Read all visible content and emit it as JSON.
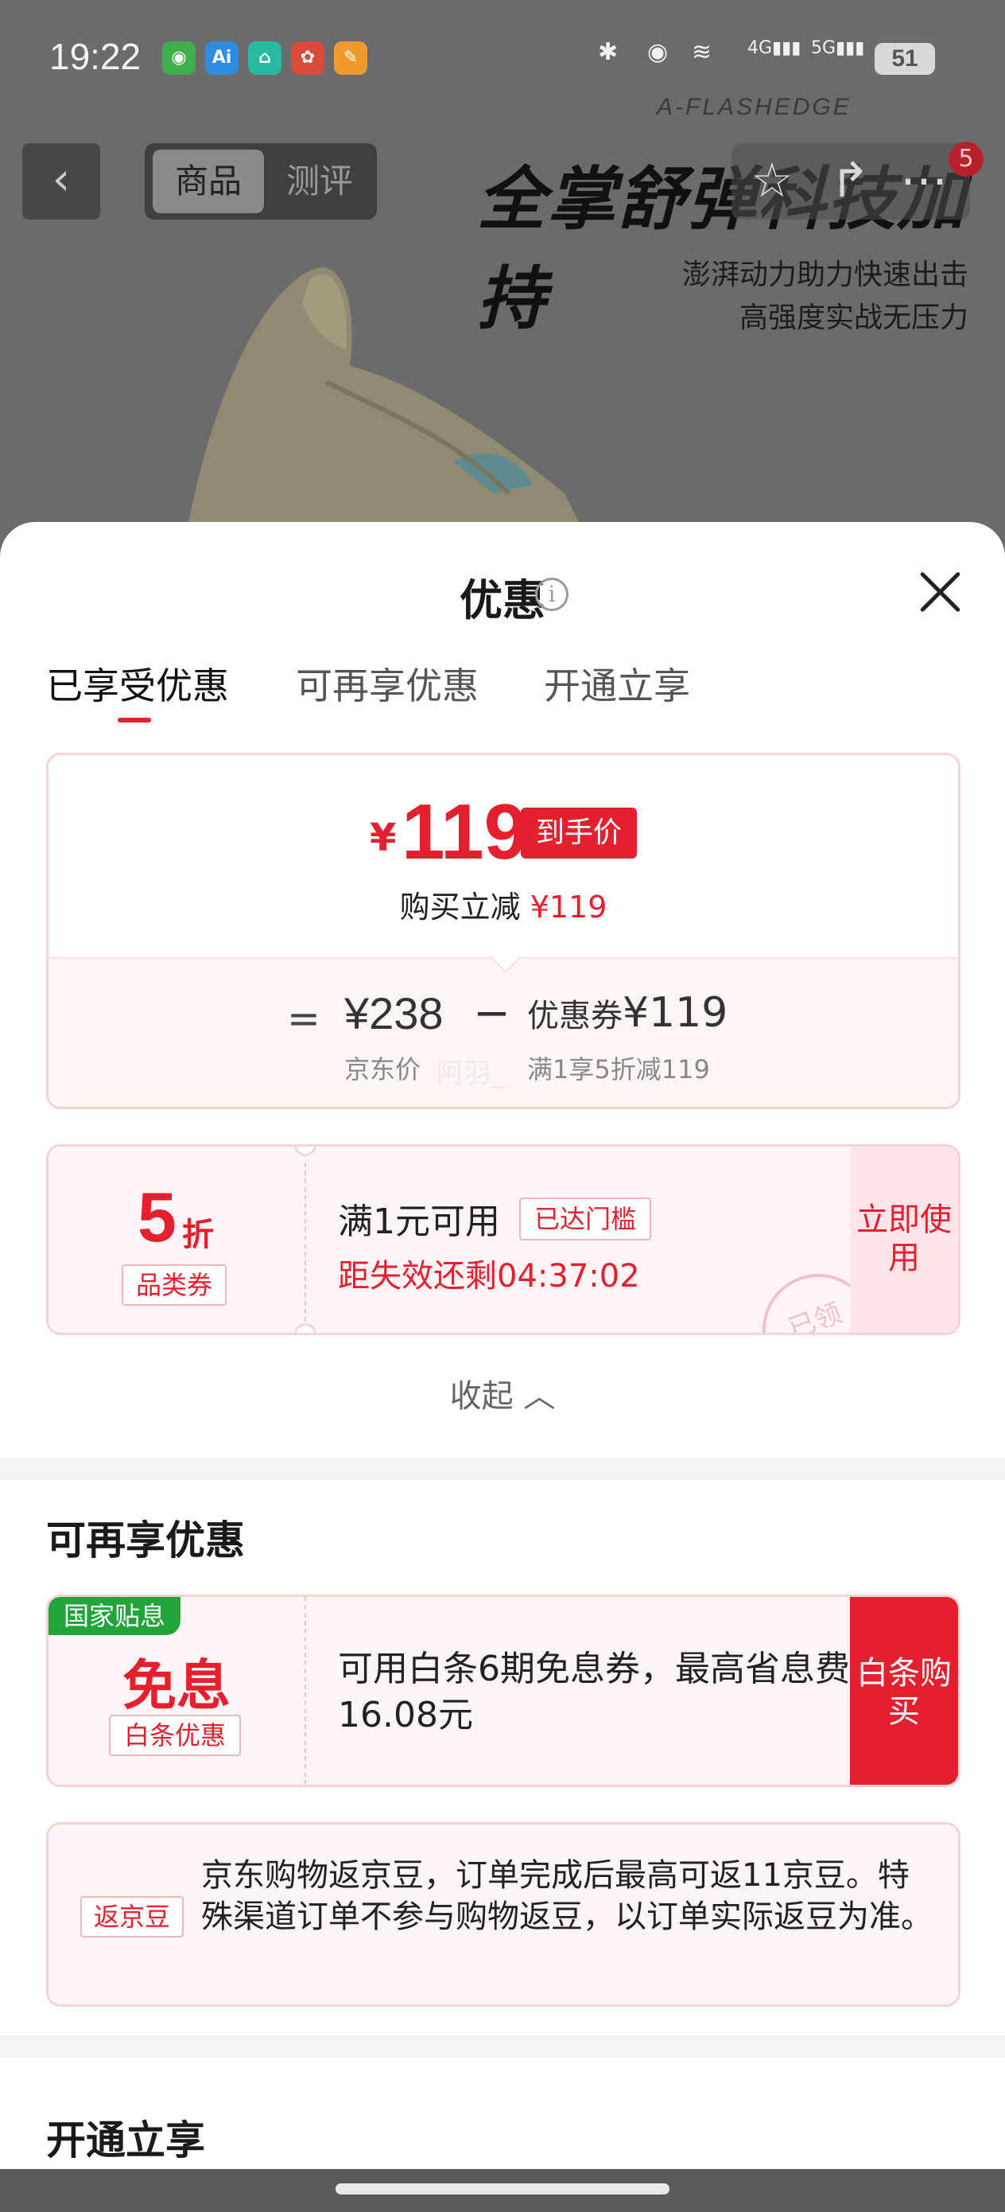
{
  "status_bar": {
    "time": "19:22",
    "apps": [
      "wechat",
      "ai",
      "app3",
      "app4",
      "app5"
    ],
    "battery": "51",
    "network": "4G 5G"
  },
  "background": {
    "brand": "A-FLASHEDGE",
    "tabs": [
      "商品",
      "测评"
    ],
    "headline": "全掌舒弹科技加持",
    "sub1": "澎湃动力助力快速出击",
    "sub2": "高强度实战无压力",
    "cart_count": "5"
  },
  "sheet": {
    "title": "优惠",
    "tabs": [
      "已享受优惠",
      "可再享优惠",
      "开通立享"
    ],
    "price": {
      "currency": "¥",
      "amount": "119",
      "final_tag": "到手价",
      "reduce_label": "购买立减",
      "reduce_amount": "¥119",
      "equals": "=",
      "jd_price": "¥238",
      "minus": "−",
      "coupon_label": "优惠券",
      "coupon_amount": "¥119",
      "jd_price_label": "京东价",
      "watermark": "阿羽_",
      "coupon_desc": "满1享5折减119"
    },
    "discount_coupon": {
      "value": "5",
      "unit": "折",
      "type": "品类券",
      "condition": "满1元可用",
      "reached": "已达门槛",
      "countdown": "距失效还剩04:37:02",
      "use_label": "立即使用",
      "stamp": "已领"
    },
    "collapse_label": "收起 ︿",
    "more_section": {
      "title": "可再享优惠",
      "interest_free": {
        "tag": "国家贴息",
        "big": "免息",
        "sub": "白条优惠",
        "desc": "可用白条6期免息券，最高省息费16.08元",
        "button": "白条购买"
      },
      "beans": {
        "tag": "返京豆",
        "desc": "京东购物返京豆，订单完成后最高可返11京豆。特殊渠道订单不参与购物返豆，以订单实际返豆为准。"
      }
    },
    "open_section": {
      "title": "开通立享"
    }
  },
  "colors": {
    "accent": "#e4202e",
    "tag_green": "#21a53a",
    "card_bg": "#fff5f6"
  }
}
